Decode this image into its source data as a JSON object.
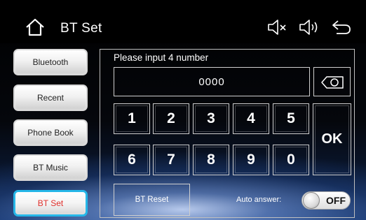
{
  "header": {
    "title": "BT Set",
    "icons": [
      "home-icon",
      "mute-icon",
      "volume-icon",
      "back-icon"
    ]
  },
  "sidebar": {
    "items": [
      {
        "label": "Bluetooth",
        "active": false
      },
      {
        "label": "Recent",
        "active": false
      },
      {
        "label": "Phone Book",
        "active": false
      },
      {
        "label": "BT Music",
        "active": false
      },
      {
        "label": "BT Set",
        "active": true
      }
    ]
  },
  "pin_entry": {
    "prompt": "Please input 4 number",
    "value": "0000",
    "backspace_icon": "backspace-icon"
  },
  "keypad": {
    "keys": [
      "1",
      "2",
      "3",
      "4",
      "5",
      "6",
      "7",
      "8",
      "9",
      "0"
    ],
    "ok_label": "OK"
  },
  "footer": {
    "reset_label": "BT Reset",
    "auto_answer_label": "Auto answer:",
    "auto_answer_state": "OFF"
  },
  "colors": {
    "active_border": "#26b7e8",
    "active_text": "#e0302c",
    "text": "#ffffff"
  }
}
